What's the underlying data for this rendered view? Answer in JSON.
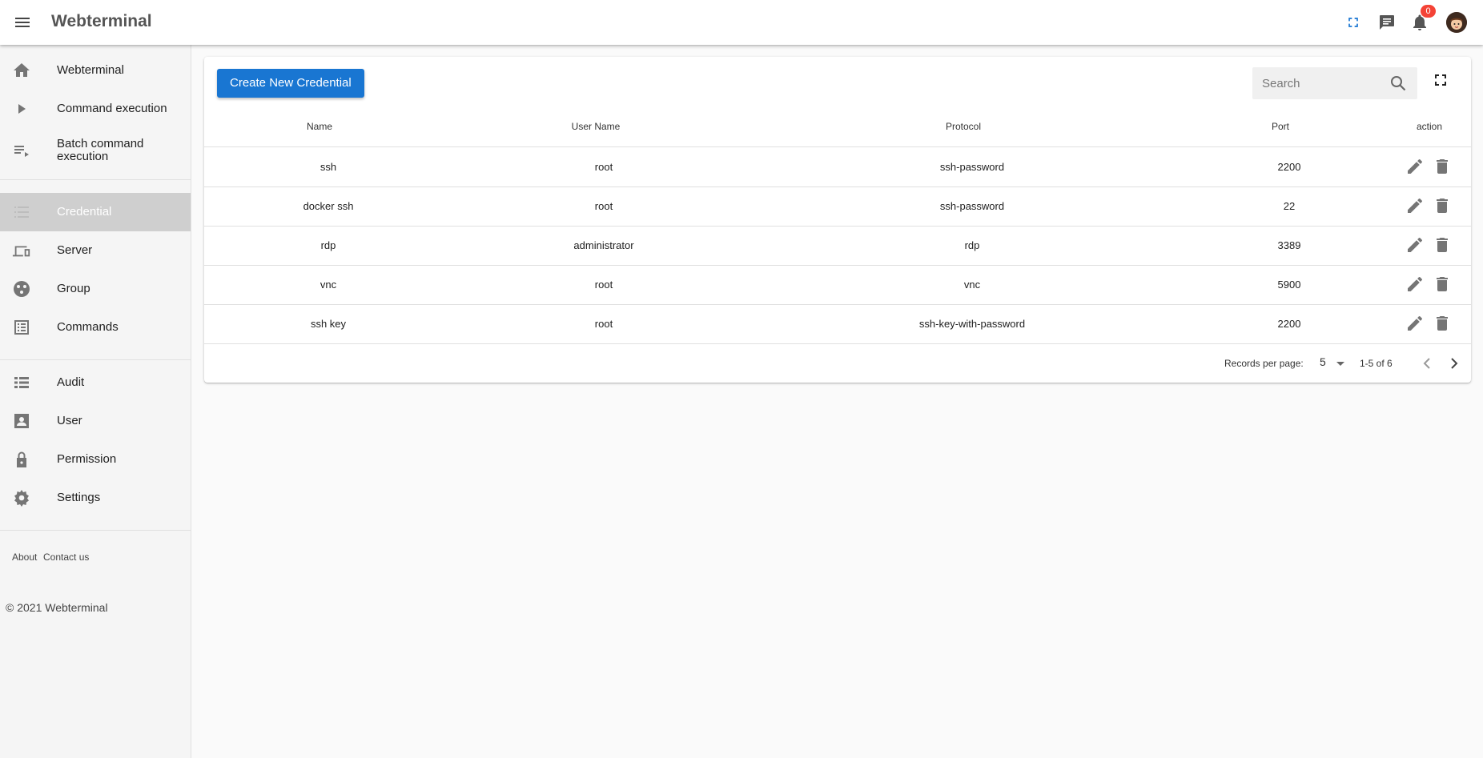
{
  "header": {
    "title": "Webterminal",
    "notification_count": "0",
    "icons": [
      "menu-icon",
      "fullscreen-icon",
      "chat-icon",
      "bell-icon",
      "avatar"
    ]
  },
  "sidebar": {
    "items": [
      {
        "label": "Webterminal",
        "icon": "home-icon"
      },
      {
        "label": "Command execution",
        "icon": "play-icon"
      },
      {
        "label": "Batch command execution",
        "icon": "playlist-icon"
      },
      {
        "label": "Credential",
        "icon": "list-icon",
        "active": true
      },
      {
        "label": "Server",
        "icon": "devices-icon"
      },
      {
        "label": "Group",
        "icon": "group-icon"
      },
      {
        "label": "Commands",
        "icon": "commands-icon"
      },
      {
        "label": "Audit",
        "icon": "audit-list-icon"
      },
      {
        "label": "User",
        "icon": "user-card-icon"
      },
      {
        "label": "Permission",
        "icon": "lock-icon"
      },
      {
        "label": "Settings",
        "icon": "gear-icon"
      }
    ],
    "footer_links": [
      "About",
      "Contact us"
    ],
    "copyright": "© 2021 Webterminal"
  },
  "toolbar": {
    "create_label": "Create New Credential",
    "search_placeholder": "Search"
  },
  "table": {
    "columns": [
      "Name",
      "User Name",
      "Protocol",
      "Port",
      "action"
    ],
    "rows": [
      {
        "name": "ssh",
        "username": "root",
        "protocol": "ssh-password",
        "port": "2200"
      },
      {
        "name": "docker ssh",
        "username": "root",
        "protocol": "ssh-password",
        "port": "22"
      },
      {
        "name": "rdp",
        "username": "administrator",
        "protocol": "rdp",
        "port": "3389"
      },
      {
        "name": "vnc",
        "username": "root",
        "protocol": "vnc",
        "port": "5900"
      },
      {
        "name": "ssh key",
        "username": "root",
        "protocol": "ssh-key-with-password",
        "port": "2200"
      }
    ]
  },
  "pagination": {
    "records_label": "Records per page:",
    "per_page": "5",
    "range": "1-5 of 6"
  },
  "colors": {
    "primary": "#1976d2",
    "badge": "#f44336",
    "active_nav": "#cfcfcf",
    "icon_grey": "#757575"
  }
}
